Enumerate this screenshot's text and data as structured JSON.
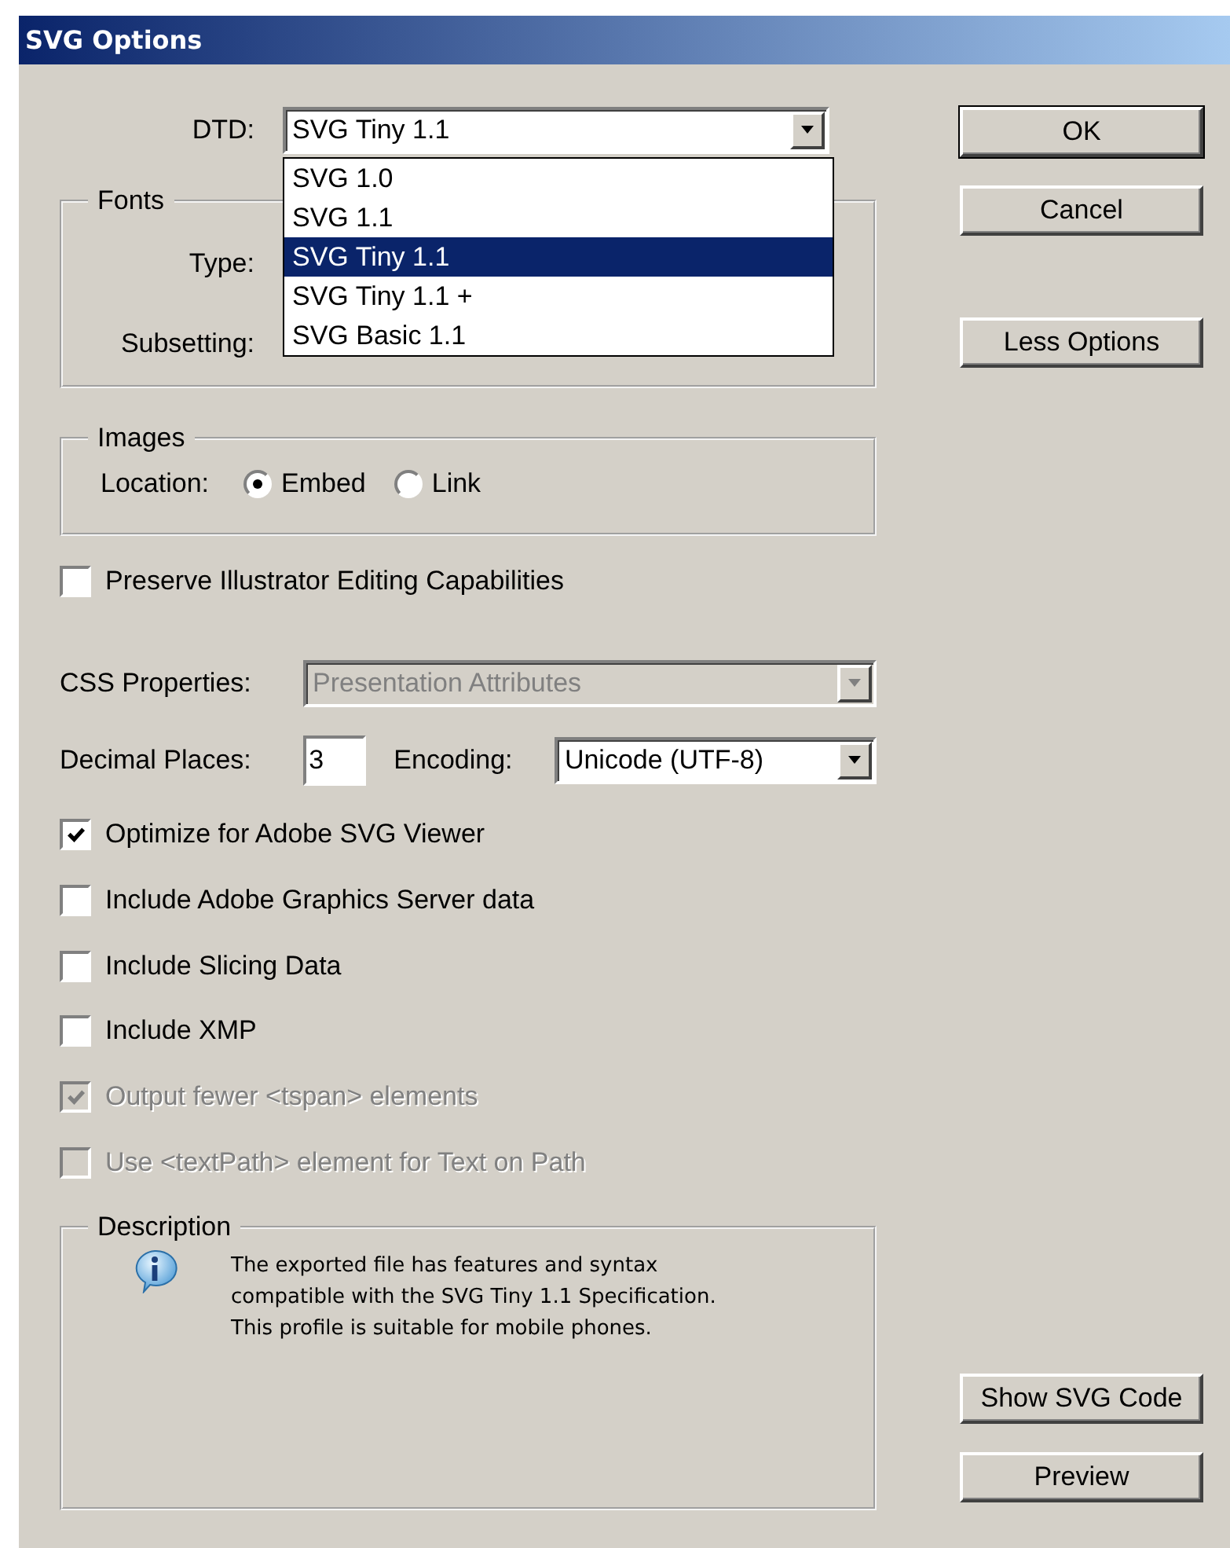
{
  "window": {
    "title": "SVG Options"
  },
  "dtd": {
    "label": "DTD:",
    "value": "SVG Tiny 1.1",
    "expanded": true,
    "options": [
      {
        "label": "SVG 1.0",
        "selected": false
      },
      {
        "label": "SVG 1.1",
        "selected": false
      },
      {
        "label": "SVG Tiny 1.1",
        "selected": true
      },
      {
        "label": "SVG Tiny 1.1 +",
        "selected": false
      },
      {
        "label": "SVG Basic 1.1",
        "selected": false
      }
    ]
  },
  "fonts": {
    "title": "Fonts",
    "fields": [
      {
        "label": "Type:"
      },
      {
        "label": "Subsetting:"
      }
    ]
  },
  "images": {
    "title": "Images",
    "label": "Location:",
    "options": [
      {
        "label": "Embed",
        "selected": true
      },
      {
        "label": "Link",
        "selected": false
      }
    ]
  },
  "preserve": {
    "label": "Preserve Illustrator Editing Capabilities",
    "checked": false
  },
  "css_properties": {
    "label": "CSS Properties:",
    "value": "Presentation Attributes",
    "disabled": true
  },
  "decimal_places": {
    "label": "Decimal Places:",
    "value": "3"
  },
  "encoding": {
    "label": "Encoding:",
    "value": "Unicode (UTF-8)",
    "disabled": false
  },
  "options": [
    {
      "label": "Optimize for Adobe SVG Viewer",
      "checked": true,
      "disabled": false
    },
    {
      "label": "Include Adobe Graphics Server data",
      "checked": false,
      "disabled": false
    },
    {
      "label": "Include Slicing Data",
      "checked": false,
      "disabled": false
    },
    {
      "label": "Include XMP",
      "checked": false,
      "disabled": false
    },
    {
      "label": "Output fewer <tspan> elements",
      "checked": true,
      "disabled": true
    },
    {
      "label": "Use <textPath> element for Text on Path",
      "checked": false,
      "disabled": true
    }
  ],
  "description": {
    "title": "Description",
    "text": "The exported file has features and syntax\ncompatible with the SVG Tiny 1.1 Specification.\nThis profile is suitable for mobile phones."
  },
  "actions": [
    {
      "label": "OK",
      "default": true
    },
    {
      "label": "Cancel",
      "default": false
    },
    {
      "label": "Less Options",
      "default": false
    }
  ],
  "extra_actions": [
    {
      "label": "Show SVG Code",
      "default": false
    },
    {
      "label": "Preview",
      "default": false
    }
  ]
}
